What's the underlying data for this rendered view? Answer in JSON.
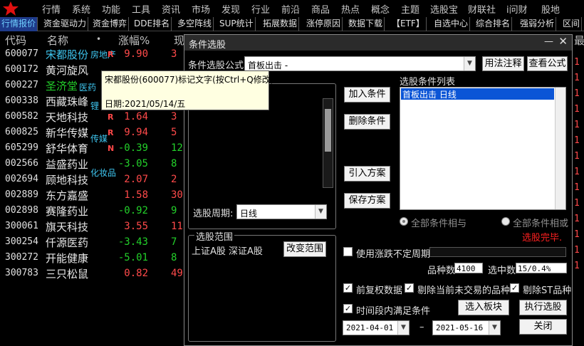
{
  "menu": [
    "行情",
    "系统",
    "功能",
    "工具",
    "资讯",
    "市场",
    "发现",
    "行业",
    "前沿",
    "商品",
    "热点",
    "概念",
    "主题",
    "选股宝",
    "财联社",
    "i问财",
    "股地"
  ],
  "tabs": [
    "行情报价",
    "资金驱动力",
    "资金博弈",
    "DDE排名",
    "多空阵线",
    "SUP统计",
    "拓展数据",
    "涨停原因",
    "数据下载",
    "【ETF】",
    "自选中心",
    "综合排名",
    "强弱分析",
    "区间"
  ],
  "header": {
    "code": "代码",
    "name": "名称",
    "dot": "•",
    "pct": "涨幅%",
    "price": "现",
    "right": "最"
  },
  "rows": [
    {
      "code": "600077",
      "name": "宋都股份",
      "note": "房地产",
      "flag": "R",
      "pct": "9.90",
      "px": "3",
      "dir": "up"
    },
    {
      "code": "600172",
      "name": "黄河旋风",
      "note": "",
      "flag": "",
      "pct": "",
      "px": "",
      "dir": "up"
    },
    {
      "code": "600227",
      "name": "圣济堂",
      "note": "医药",
      "flag": "",
      "pct": "",
      "px": "",
      "dir": "up"
    },
    {
      "code": "600338",
      "name": "西藏珠峰",
      "note": "锂",
      "flag": "",
      "pct": "",
      "px": "",
      "dir": "up"
    },
    {
      "code": "600582",
      "name": "天地科技",
      "note": "",
      "flag": "R",
      "pct": "1.64",
      "px": "3",
      "dir": "up"
    },
    {
      "code": "600825",
      "name": "新华传媒",
      "note": "传媒",
      "flag": "R",
      "pct": "9.94",
      "px": "5",
      "dir": "up"
    },
    {
      "code": "605299",
      "name": "舒华体育",
      "note": "",
      "flag": "N",
      "pct": "-0.39",
      "px": "12",
      "dir": "down"
    },
    {
      "code": "002566",
      "name": "益盛药业",
      "note": "化妆品",
      "flag": "",
      "pct": "-3.05",
      "px": "8",
      "dir": "down"
    },
    {
      "code": "002694",
      "name": "顾地科技",
      "note": "",
      "flag": "",
      "pct": "2.07",
      "px": "2",
      "dir": "up"
    },
    {
      "code": "002889",
      "name": "东方嘉盛",
      "note": "",
      "flag": "",
      "pct": "1.58",
      "px": "30",
      "dir": "up"
    },
    {
      "code": "002898",
      "name": "赛隆药业",
      "note": "",
      "flag": "",
      "pct": "-0.92",
      "px": "9",
      "dir": "down"
    },
    {
      "code": "300061",
      "name": "旗天科技",
      "note": "",
      "flag": "",
      "pct": "3.55",
      "px": "11",
      "dir": "up"
    },
    {
      "code": "300254",
      "name": "仟源医药",
      "note": "",
      "flag": "",
      "pct": "-3.43",
      "px": "7",
      "dir": "down"
    },
    {
      "code": "300272",
      "name": "开能健康",
      "note": "",
      "flag": "",
      "pct": "-5.01",
      "px": "8",
      "dir": "down"
    },
    {
      "code": "300783",
      "name": "三只松鼠",
      "note": "",
      "flag": "",
      "pct": "0.82",
      "px": "49",
      "dir": "up"
    }
  ],
  "right_strip": [
    "1",
    "1",
    "1",
    "1",
    "1",
    "1",
    "1",
    "1",
    "1",
    "1",
    "1",
    "1",
    "1",
    "1"
  ],
  "tooltip": {
    "line1": "宋都股份(600077)标记文字(按Ctrl+Q修改)",
    "line2": "日期:2021/05/14/五"
  },
  "dialog": {
    "title": "条件选股",
    "formula_label": "条件选股公式",
    "formula_value": "首板出击     -",
    "btn_usage": "用法注释",
    "btn_view": "查看公式",
    "list_label": "选股条件列表",
    "list_items": [
      "首板出击  日线"
    ],
    "btn_add": "加入条件",
    "btn_del": "删除条件",
    "btn_import": "引入方案",
    "btn_save": "保存方案",
    "period_label": "选股周期:",
    "period_value": "日线",
    "radio_and": "全部条件相与",
    "radio_or": "全部条件相或",
    "status": "选股完毕.",
    "range_group": "选股范围",
    "range_value": "上证A股 深证A股",
    "btn_range": "改变范围",
    "uncertain_cycle": "使用涨跌不定周期",
    "count_label": "品种数",
    "count_value": "4100",
    "selected_label": "选中数",
    "selected_value": "15/0.4%",
    "chk_prefq": "前复权数据",
    "chk_excl_nontrade": "剔除当前未交易的品种",
    "chk_excl_st": "剔除ST品种",
    "chk_period": "时间段内满足条件",
    "btn_to_block": "选入板块",
    "btn_run": "执行选股",
    "date_from": "2021-04-01",
    "date_sep": "–",
    "date_to": "2021-05-16",
    "btn_close": "关闭",
    "min_glyph": "—",
    "close_glyph": "✕"
  },
  "colors": {
    "up": "#ff4a4a",
    "down": "#23d02a",
    "note": "#3ec6f0",
    "active_tab": "#1e3a8a",
    "selection": "#0b55d6",
    "status": "#ff2020"
  }
}
